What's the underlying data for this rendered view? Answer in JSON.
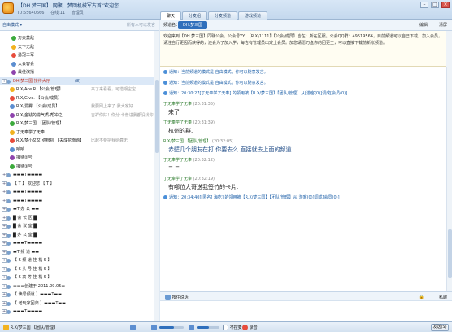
{
  "window": {
    "title": "【DH.梦三国】 网聚、梦回机械军古首“欢迎您",
    "id": "ID:55640666",
    "online": "在线:11",
    "manage": "管理员"
  },
  "tabs": [
    "聊天",
    "分麦组",
    "分麦频道",
    "游戏频道"
  ],
  "left": {
    "mode": "自由模式 ▾",
    "hint": "所有人可以发言",
    "rows": [
      {
        "label": "万夫莫敌",
        "indent": 12
      },
      {
        "label": "天下无敌",
        "indent": 12
      },
      {
        "label": "勇冠三军",
        "indent": 12
      },
      {
        "label": "大会客会",
        "indent": 12
      },
      {
        "label": "最佳演播",
        "indent": 12
      },
      {
        "label": "DH.梦三国   接待大厅",
        "indent": 6,
        "extra": "(8)",
        "selected": true
      },
      {
        "label": "R.X/Ace.R  【公会/管理】",
        "indent": 10,
        "note": "来了来看看，可惜期宝宝..."
      },
      {
        "label": "R.X/Give.  【公会/成员】",
        "indent": 10
      },
      {
        "label": "R.X/爱雾  【公会/成员】",
        "indent": 10,
        "note": "我要网上来了  我大家好"
      },
      {
        "label": "R.X/金钱的捞气质-帮冲之",
        "indent": 10,
        "note": "吉祥你好！你分·卡普进我都没找你"
      },
      {
        "label": "R.X/梦三国  【团队/管理】",
        "indent": 10
      },
      {
        "label": "丁无奉学了无奉",
        "indent": 10
      },
      {
        "label": "R.X/梦小又又 弥根机  【夫成花面题】",
        "indent": 10,
        "note": "比起不要把我给算无"
      },
      {
        "label": "哈哈",
        "indent": 10
      },
      {
        "label": "接待②号",
        "indent": 10
      },
      {
        "label": "接待③号",
        "indent": 10
      },
      {
        "label": "▬▬▬T▬▬▬▬",
        "indent": 6
      },
      {
        "label": "【  T  】   欢迎您   【 T 】",
        "indent": 6
      },
      {
        "label": "▬▬▬T▬▬▬▬",
        "indent": 6
      },
      {
        "label": "▬▬▬T▬▬▬▬",
        "indent": 6
      },
      {
        "label": "▬T 办   公 ▬▬",
        "indent": 6
      },
      {
        "label": "█    会      长     区    █",
        "indent": 6
      },
      {
        "label": "█    会      议     室    █",
        "indent": 6
      },
      {
        "label": "█    办      公     室    █",
        "indent": 6
      },
      {
        "label": "▬▬▬T▬▬▬▬",
        "indent": 6
      },
      {
        "label": "▬T 频   道 ▬▬",
        "indent": 6
      },
      {
        "label": "【   S    频    道    挂    机    S   】",
        "indent": 6
      },
      {
        "label": "【   S    头    号    挂    机    S   】",
        "indent": 6
      },
      {
        "label": "【   S    高    等    挂    机    S   】",
        "indent": 6
      },
      {
        "label": "▬▬▬创建于 2011.09.05▬",
        "indent": 6
      },
      {
        "label": "【 读号频道 】▬▬▬T▬▬",
        "indent": 6
      },
      {
        "label": "【 老玩家回归 】▬▬▬T▬▬",
        "indent": 6
      },
      {
        "label": "▬▬▬T▬▬▬▬",
        "indent": 6
      }
    ]
  },
  "room": {
    "label": "频道名：",
    "name": "DH.梦三国",
    "edit": "编辑",
    "clear": "清屏"
  },
  "notice": "欢迎来到【DH.梦三国】同聊公会。公会号YY：【R.X/1111】【公会/成员】皆在：所在区服。公会QQ群：49519566，目前频道可以自己下载，加入会员，请注自行更因而获得的，还会为了加入学，每告有管理员出定上会员。加您请愿刀盘你的团更王，可以直接下载前新帐频道。",
  "chat": [
    {
      "kind": "sys",
      "text": "通知：当前频道的模式是 自由模式，你可以随意发言。"
    },
    {
      "kind": "sys",
      "text": "通知：当前频道的模式是 自由模式，你可以随意发言。"
    },
    {
      "kind": "sys",
      "text": "通知：20:30:27[丁无奉学了无奉] 的领用被【R.X/梦三国】【团队/管理】从[游客(0)]调成[会员(0)]"
    },
    {
      "kind": "sender",
      "name": "丁无奉学了无奉",
      "time": "(20:31:35)"
    },
    {
      "kind": "body",
      "text": "来了"
    },
    {
      "kind": "sender",
      "name": "丁无奉学了无奉",
      "time": "(20:31:39)"
    },
    {
      "kind": "body",
      "text": "杭州的群."
    },
    {
      "kind": "sender",
      "name": "R.X/梦三国  【团队/管理】",
      "time": "(20:32:05)"
    },
    {
      "kind": "body",
      "text": "赤壁几个朋友在打     你要去么    直接就去上面的频道",
      "blue": true
    },
    {
      "kind": "sender",
      "name": "丁无奉学了无奉",
      "time": "(20:32:12)"
    },
    {
      "kind": "body",
      "text": "= ="
    },
    {
      "kind": "sender",
      "name": "丁无奉学了无奉",
      "time": "(20:32:19)"
    },
    {
      "kind": "body",
      "text": "有哪位大哥送我签竹的卡片."
    },
    {
      "kind": "sys",
      "text": "通知：20:34:40[[匿名] 海吃] 的领用被【R.X/梦三国】【团队/管理】从[游客(0)]调成[会员(0)]"
    }
  ],
  "input": {
    "mode": "按住说话",
    "private": "私聊"
  },
  "bottom": {
    "user": "R.X/梦三国  【团队/管理】",
    "record": "录音",
    "free": "不控麦",
    "send": "发送(S)"
  },
  "colors": {
    "accent": "#2f6fbc",
    "online_dot": "#3caa3c",
    "mic_on": "#e74c3c",
    "vip": "#f2b21f"
  }
}
